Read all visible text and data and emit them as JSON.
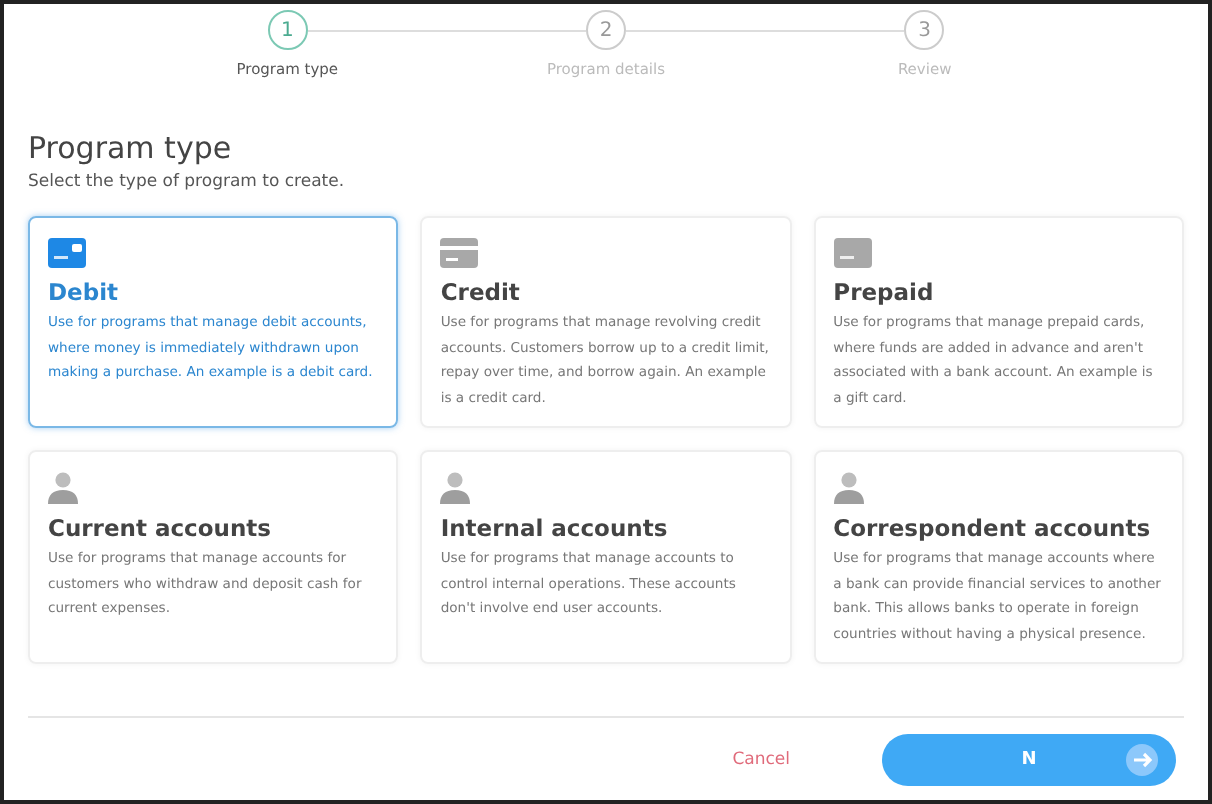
{
  "stepper": [
    {
      "number": "1",
      "label": "Program type",
      "selected": true
    },
    {
      "number": "2",
      "label": "Program details",
      "selected": false
    },
    {
      "number": "3",
      "label": "Review",
      "selected": false
    }
  ],
  "heading": "Program type",
  "subheading": "Select the type of program to create.",
  "options": [
    {
      "kind": "card",
      "title": "Debit",
      "description": "Use for programs that manage debit accounts, where money is immediately withdrawn upon making a purchase. An example is a debit card.",
      "selected": true
    },
    {
      "kind": "credit",
      "title": "Credit",
      "description": "Use for programs that manage revolving credit accounts. Customers borrow up to a credit limit, repay over time, and borrow again. An example is a credit card.",
      "selected": false
    },
    {
      "kind": "card",
      "title": "Prepaid",
      "description": "Use for programs that manage prepaid cards, where funds are added in advance and aren't associated with a bank account. An example is a gift card.",
      "selected": false
    },
    {
      "kind": "account",
      "title": "Current accounts",
      "description": "Use for programs that manage accounts for customers who withdraw and deposit cash for current expenses.",
      "selected": false
    },
    {
      "kind": "account",
      "title": "Internal accounts",
      "description": "Use for programs that manage accounts to control internal operations. These accounts don't involve end user accounts.",
      "selected": false
    },
    {
      "kind": "account",
      "title": "Correspondent accounts",
      "description": "Use for programs that manage accounts where a bank can provide financial services to another bank. This allows banks to operate in foreign countries without having a physical presence.",
      "selected": false
    }
  ],
  "footer": {
    "cancel": "Cancel",
    "next": "N"
  }
}
